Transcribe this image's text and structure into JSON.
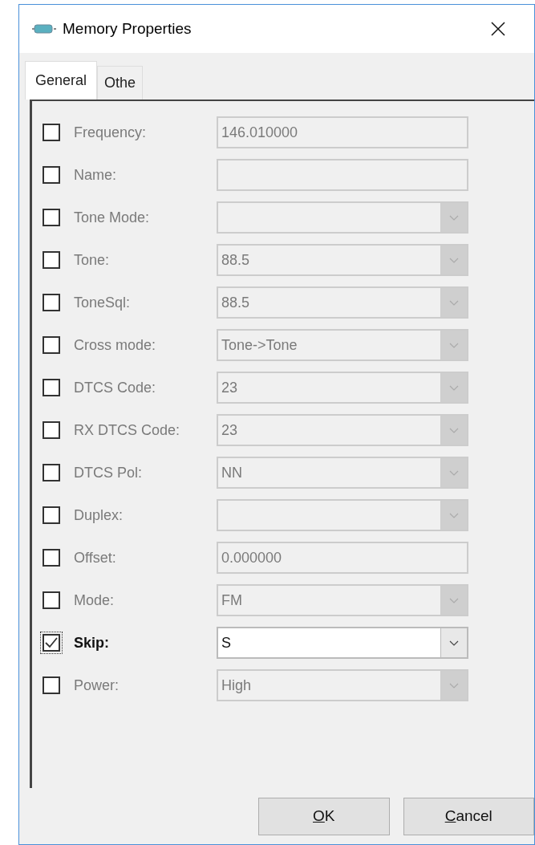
{
  "window": {
    "title": "Memory Properties"
  },
  "tabs": [
    {
      "label": "General",
      "selected": true
    },
    {
      "label": "Othe",
      "selected": false
    }
  ],
  "fields": [
    {
      "kind": "text",
      "label": "Frequency:",
      "value": "146.010000",
      "checked": false
    },
    {
      "kind": "text",
      "label": "Name:",
      "checked": false
    },
    {
      "kind": "combo",
      "label": "Tone Mode:",
      "checked": false
    },
    {
      "kind": "combo",
      "label": "Tone:",
      "value": "88.5",
      "checked": false
    },
    {
      "kind": "combo",
      "label": "ToneSql:",
      "value": "88.5",
      "checked": false
    },
    {
      "kind": "combo",
      "label": "Cross mode:",
      "value": "Tone->Tone",
      "checked": false
    },
    {
      "kind": "combo",
      "label": "DTCS Code:",
      "value": "23",
      "checked": false
    },
    {
      "kind": "combo",
      "label": "RX DTCS Code:",
      "value": "23",
      "checked": false
    },
    {
      "kind": "combo",
      "label": "DTCS Pol:",
      "value": "NN",
      "checked": false
    },
    {
      "kind": "combo",
      "label": "Duplex:",
      "checked": false
    },
    {
      "kind": "text",
      "label": "Offset:",
      "value": "0.000000",
      "checked": false
    },
    {
      "kind": "combo",
      "label": "Mode:",
      "value": "FM",
      "checked": false
    },
    {
      "kind": "combo",
      "label": "Skip:",
      "value": "S",
      "checked": true
    },
    {
      "kind": "combo",
      "label": "Power:",
      "value": "High",
      "checked": false
    }
  ],
  "buttons": [
    "OK",
    "Cancel"
  ]
}
